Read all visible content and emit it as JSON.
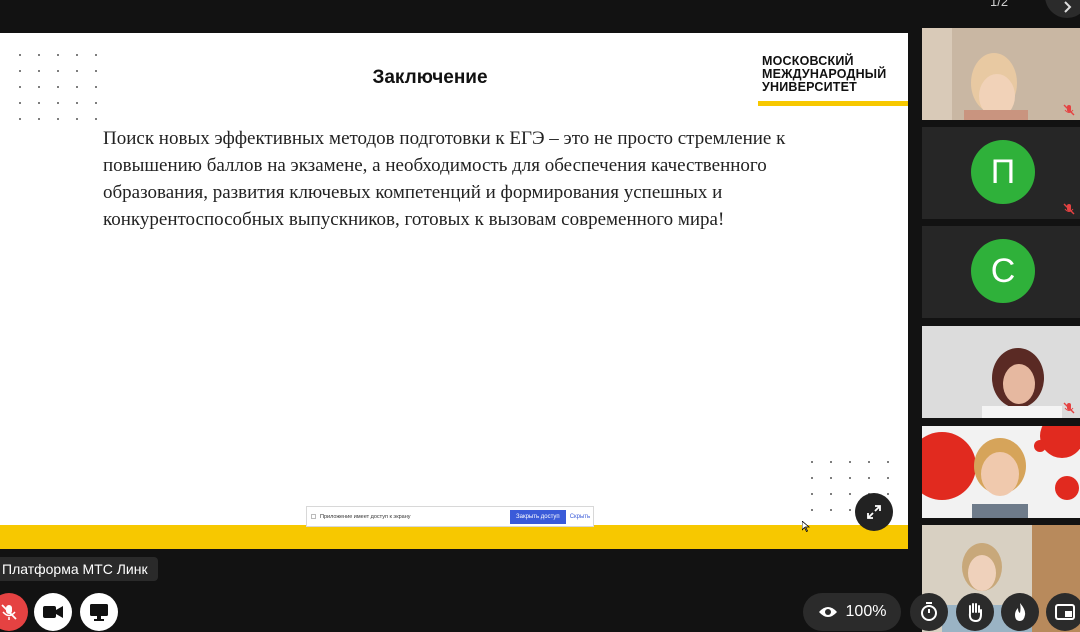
{
  "top": {
    "page_counter": "1/2"
  },
  "slide": {
    "title": "Заключение",
    "logo_lines": [
      "МОСКОВСКИЙ",
      "МЕЖДУНАРОДНЫЙ",
      "УНИВЕРСИТЕТ"
    ],
    "body": "Поиск новых эффективных методов подготовки к ЕГЭ – это не просто стремление к повышению баллов на экзамене, а необходимость для обеспечения качественного образования, развития ключевых компетенций и формирования успешных и конкурентоспособных выпускников, готовых к вызовам современного мира!",
    "share_bar": {
      "message": "Приложение имеет доступ к экрану",
      "stop_label": "Закрыть доступ",
      "hide_label": "Скрыть"
    }
  },
  "participants": [
    {
      "type": "video",
      "muted": true
    },
    {
      "type": "avatar",
      "initial": "П",
      "muted": true
    },
    {
      "type": "avatar",
      "initial": "С",
      "muted": false
    },
    {
      "type": "video",
      "muted": true
    },
    {
      "type": "video",
      "muted": false
    },
    {
      "type": "video",
      "muted": false
    }
  ],
  "bottom_bar": {
    "platform_label": "Платформа МТС Линк",
    "view_percent": "100%",
    "icons": [
      "mic-off-icon",
      "camera-icon",
      "screen-share-icon",
      "eye-icon",
      "timer-icon",
      "raise-hand-icon",
      "fire-icon",
      "picture-in-picture-icon"
    ]
  },
  "colors": {
    "accent_yellow": "#f7c800",
    "avatar_green": "#2fb13a",
    "mute_red": "#e54242",
    "share_blue": "#3a5bd9"
  }
}
